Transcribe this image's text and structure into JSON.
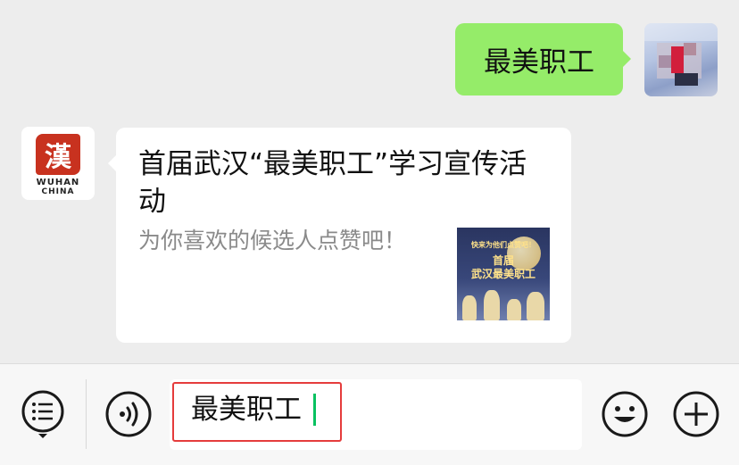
{
  "conversation": {
    "outgoing_message": "最美职工",
    "incoming_card": {
      "sender_logo_glyph": "漢",
      "sender_logo_text_line1": "WUHAN",
      "sender_logo_text_line2": "CHINA",
      "title": "首届武汉“最美职工”学习宣传活动",
      "description": "为你喜欢的候选人点赞吧！",
      "thumbnail": {
        "line1": "快来为他们点赞吧！",
        "line2": "首届",
        "line3": "武汉最美职工"
      }
    }
  },
  "input_bar": {
    "input_value": "最美职工",
    "icons": [
      "menu-list-icon",
      "voice-icon",
      "emoji-icon",
      "plus-icon"
    ]
  },
  "colors": {
    "outgoing_bubble": "#95ec69",
    "background": "#ededed",
    "highlight_border": "#e53c3c",
    "caret": "#07c160"
  }
}
